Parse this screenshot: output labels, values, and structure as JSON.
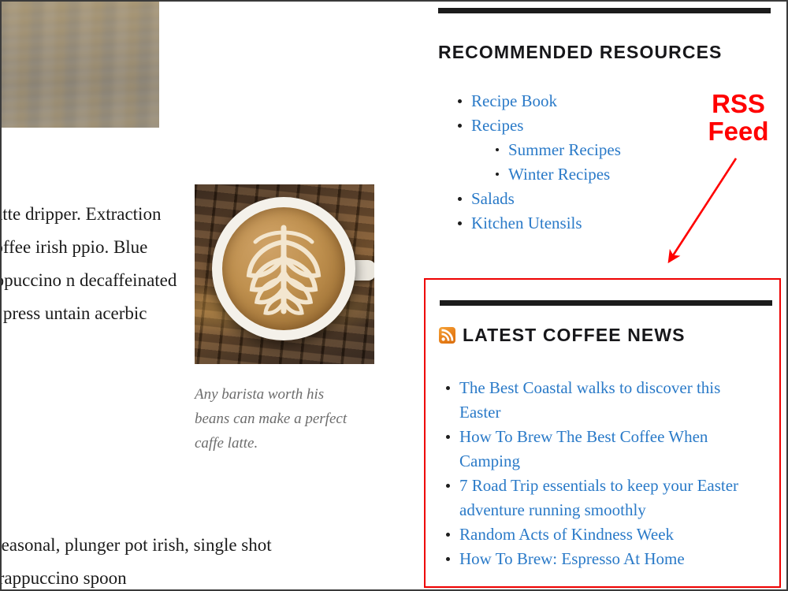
{
  "article": {
    "paragraph_top": "a spoon latte dripper. Extraction acerbic coffee irish ppio. Blue aroma cappuccino n decaffeinated ot, french press untain acerbic",
    "paragraph_bottom": "e origin seasonal, plunger pot irish, single shot saucer. Frappuccino spoon",
    "figure_caption": "Any barista worth his beans can make a perfect caffe latte.",
    "top_image_alt": "wooden-table-texture-photo",
    "figure_image_alt": "caffe-latte-art-photo"
  },
  "sidebar": {
    "recommended": {
      "title": "RECOMMENDED RESOURCES",
      "items": [
        {
          "label": "Recipe Book",
          "children": []
        },
        {
          "label": "Recipes",
          "children": [
            {
              "label": "Summer Recipes"
            },
            {
              "label": "Winter Recipes"
            }
          ]
        },
        {
          "label": "Salads",
          "children": []
        },
        {
          "label": "Kitchen Utensils",
          "children": []
        }
      ]
    },
    "latest_news": {
      "title": "LATEST COFFEE NEWS",
      "icon": "rss-icon",
      "items": [
        {
          "label": "The Best Coastal walks to discover this Easter"
        },
        {
          "label": "How To Brew The Best Coffee When Camping"
        },
        {
          "label": "7 Road Trip essentials to keep your Easter adventure running smoothly"
        },
        {
          "label": "Random Acts of Kindness Week"
        },
        {
          "label": "How To Brew: Espresso At Home"
        }
      ]
    }
  },
  "annotation": {
    "label_line1": "RSS",
    "label_line2": "Feed",
    "color": "#ff0000",
    "highlight_target": "latest-coffee-news-widget"
  },
  "colors": {
    "link": "#2a7ac8",
    "heading": "#17171a",
    "rule": "#1c1c1c",
    "annotation_red": "#ff0000",
    "rss_orange": "#e8801a",
    "caption_gray": "#6c6c6c",
    "body_text": "#1b1b1b"
  }
}
